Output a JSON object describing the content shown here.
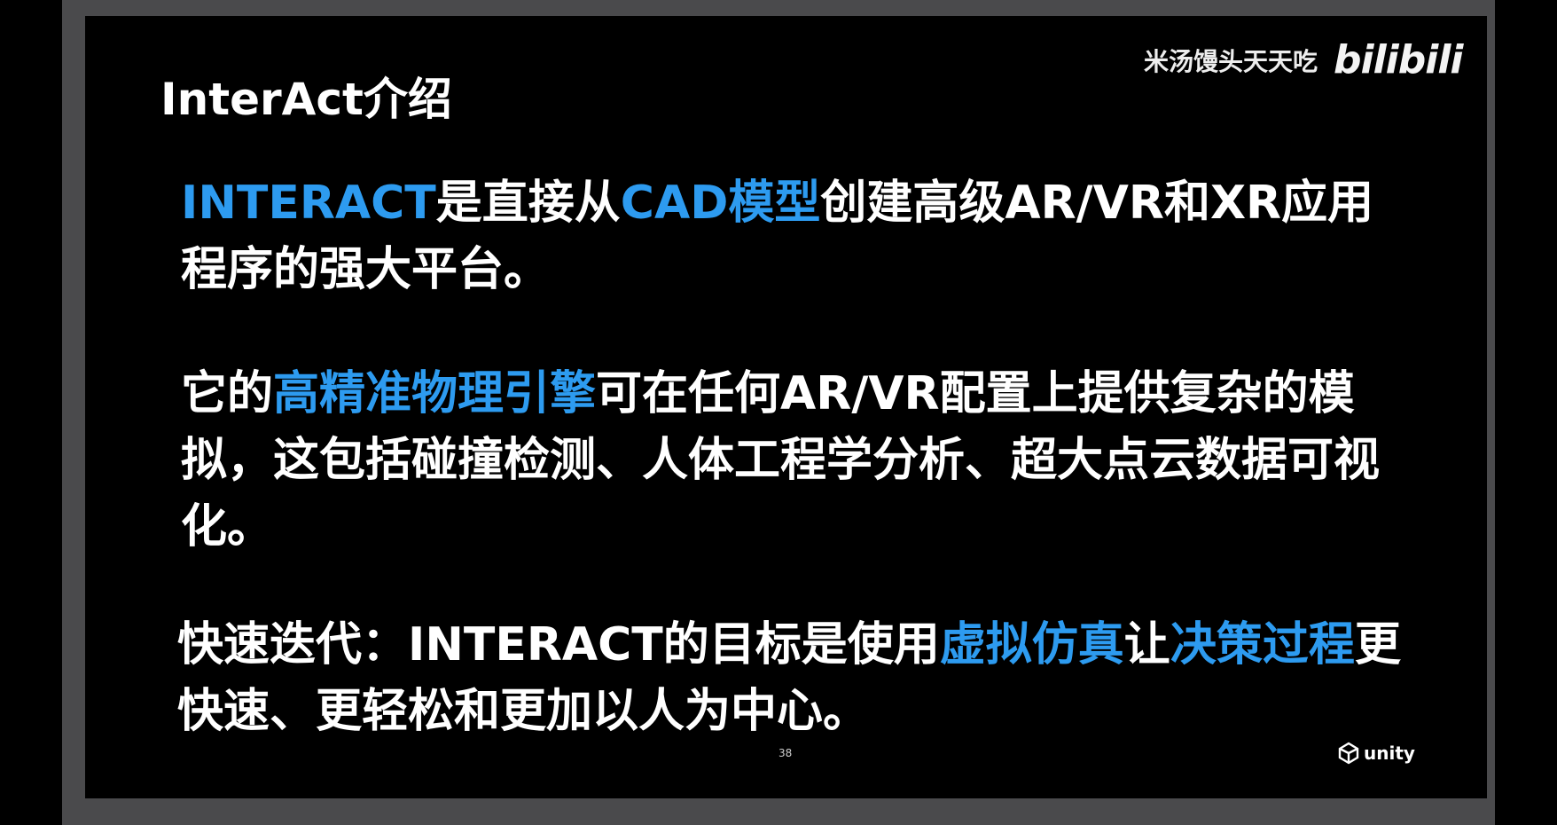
{
  "watermark": {
    "uploader": "米汤馒头天天吃",
    "site_logo": "bilibili"
  },
  "slide": {
    "title": "InterAct介绍",
    "paragraph_1": [
      {
        "text": "INTERACT",
        "highlight": true
      },
      {
        "text": "是直接从",
        "highlight": false
      },
      {
        "text": "CAD模型",
        "highlight": true
      },
      {
        "text": "创建高级AR/VR和XR应用程序的强大平台。",
        "highlight": false
      }
    ],
    "paragraph_2": [
      {
        "text": "它的",
        "highlight": false
      },
      {
        "text": "高精准物理引擎",
        "highlight": true
      },
      {
        "text": "可在任何AR/VR配置上提供复杂的模拟，这包括碰撞检测、人体工程学分析、超大点云数据可视化。",
        "highlight": false
      }
    ],
    "paragraph_3": [
      {
        "text": "快速迭代：INTERACT的目标是使用",
        "highlight": false
      },
      {
        "text": "虚拟仿真",
        "highlight": true
      },
      {
        "text": "让",
        "highlight": false
      },
      {
        "text": "决策过程",
        "highlight": true
      },
      {
        "text": "更快速、更轻松和更加以人为中心。",
        "highlight": false
      }
    ],
    "page_number": "38",
    "brand_logo": "unity",
    "colors": {
      "highlight": "#2d9bf0",
      "text": "#ffffff",
      "background": "#000000"
    }
  }
}
